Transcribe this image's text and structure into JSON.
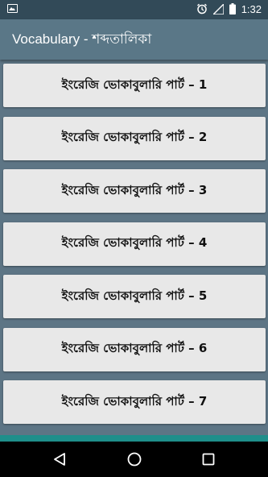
{
  "status_bar": {
    "time": "1:32",
    "icons": [
      "image-icon",
      "alarm-icon",
      "signal-icon",
      "battery-icon"
    ]
  },
  "app_bar": {
    "title": "Vocabulary - শব্দতালিকা"
  },
  "list": {
    "items": [
      {
        "label": "ইংরেজি ভোকাবুলারি পার্ট – 1"
      },
      {
        "label": "ইংরেজি ভোকাবুলারি পার্ট – 2"
      },
      {
        "label": "ইংরেজি ভোকাবুলারি পার্ট – 3"
      },
      {
        "label": "ইংরেজি ভোকাবুলারি পার্ট – 4"
      },
      {
        "label": "ইংরেজি ভোকাবুলারি পার্ট – 5"
      },
      {
        "label": "ইংরেজি ভোকাবুলারি পার্ট – 6"
      },
      {
        "label": "ইংরেজি ভোকাবুলারি পার্ট – 7"
      }
    ]
  },
  "nav_bar": {
    "icons": [
      "back-icon",
      "home-icon",
      "recents-icon"
    ]
  },
  "colors": {
    "status_bar": "#324a58",
    "app_bar": "#5a7787",
    "background": "#5d7585",
    "button": "#e8e8e8",
    "accent_strip": "#1f8f8b",
    "nav_bar": "#000000"
  }
}
